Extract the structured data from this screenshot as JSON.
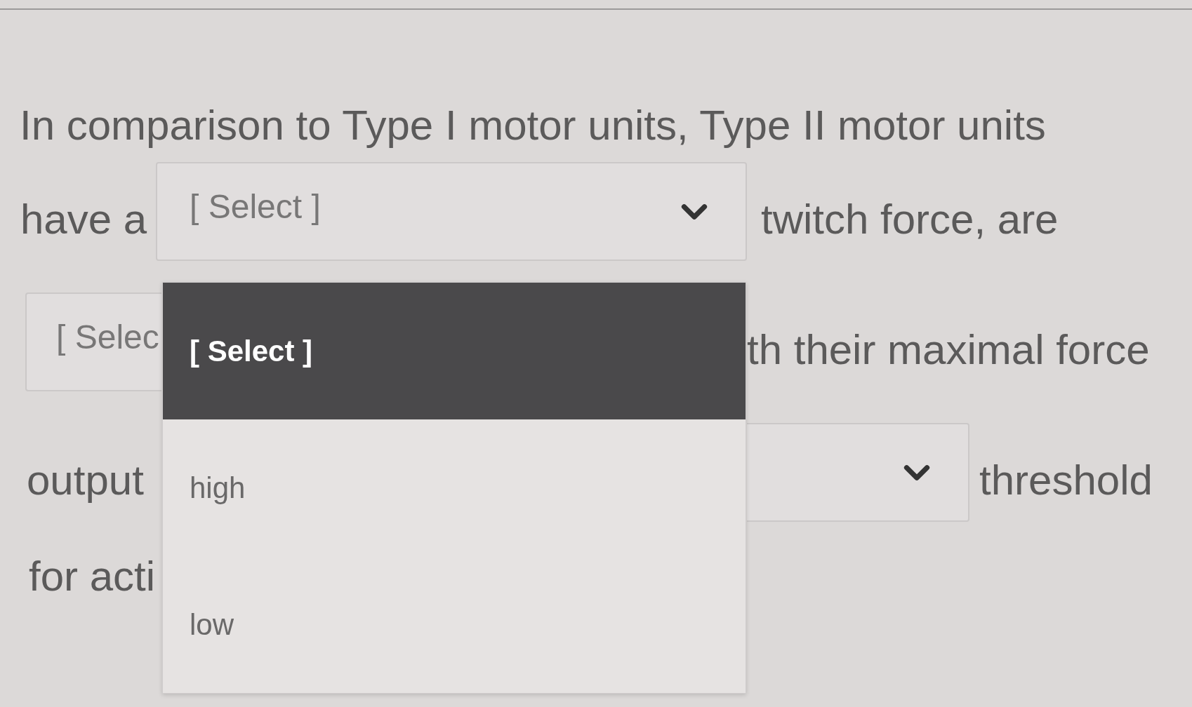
{
  "question": {
    "lines": [
      {
        "items": [
          {
            "kind": "text",
            "text": "In comparison to Type I motor units, Type II motor units"
          }
        ]
      },
      {
        "items": [
          {
            "kind": "text",
            "text": "have a"
          },
          {
            "kind": "select",
            "value": "[ Select ]",
            "expanded": true,
            "options": [
              {
                "label": "[ Select ]",
                "selected": true
              },
              {
                "label": "high",
                "selected": false
              },
              {
                "label": "low",
                "selected": false
              }
            ]
          },
          {
            "kind": "text",
            "text": "twitch force, are"
          }
        ]
      },
      {
        "items": [
          {
            "kind": "select",
            "value": "[ Selec"
          },
          {
            "kind": "text",
            "text": "th their maximal force"
          }
        ]
      },
      {
        "items": [
          {
            "kind": "text",
            "text": "output"
          },
          {
            "kind": "select"
          },
          {
            "kind": "text",
            "text": "threshold"
          }
        ]
      },
      {
        "items": [
          {
            "kind": "text",
            "text": "for acti"
          }
        ]
      }
    ]
  }
}
